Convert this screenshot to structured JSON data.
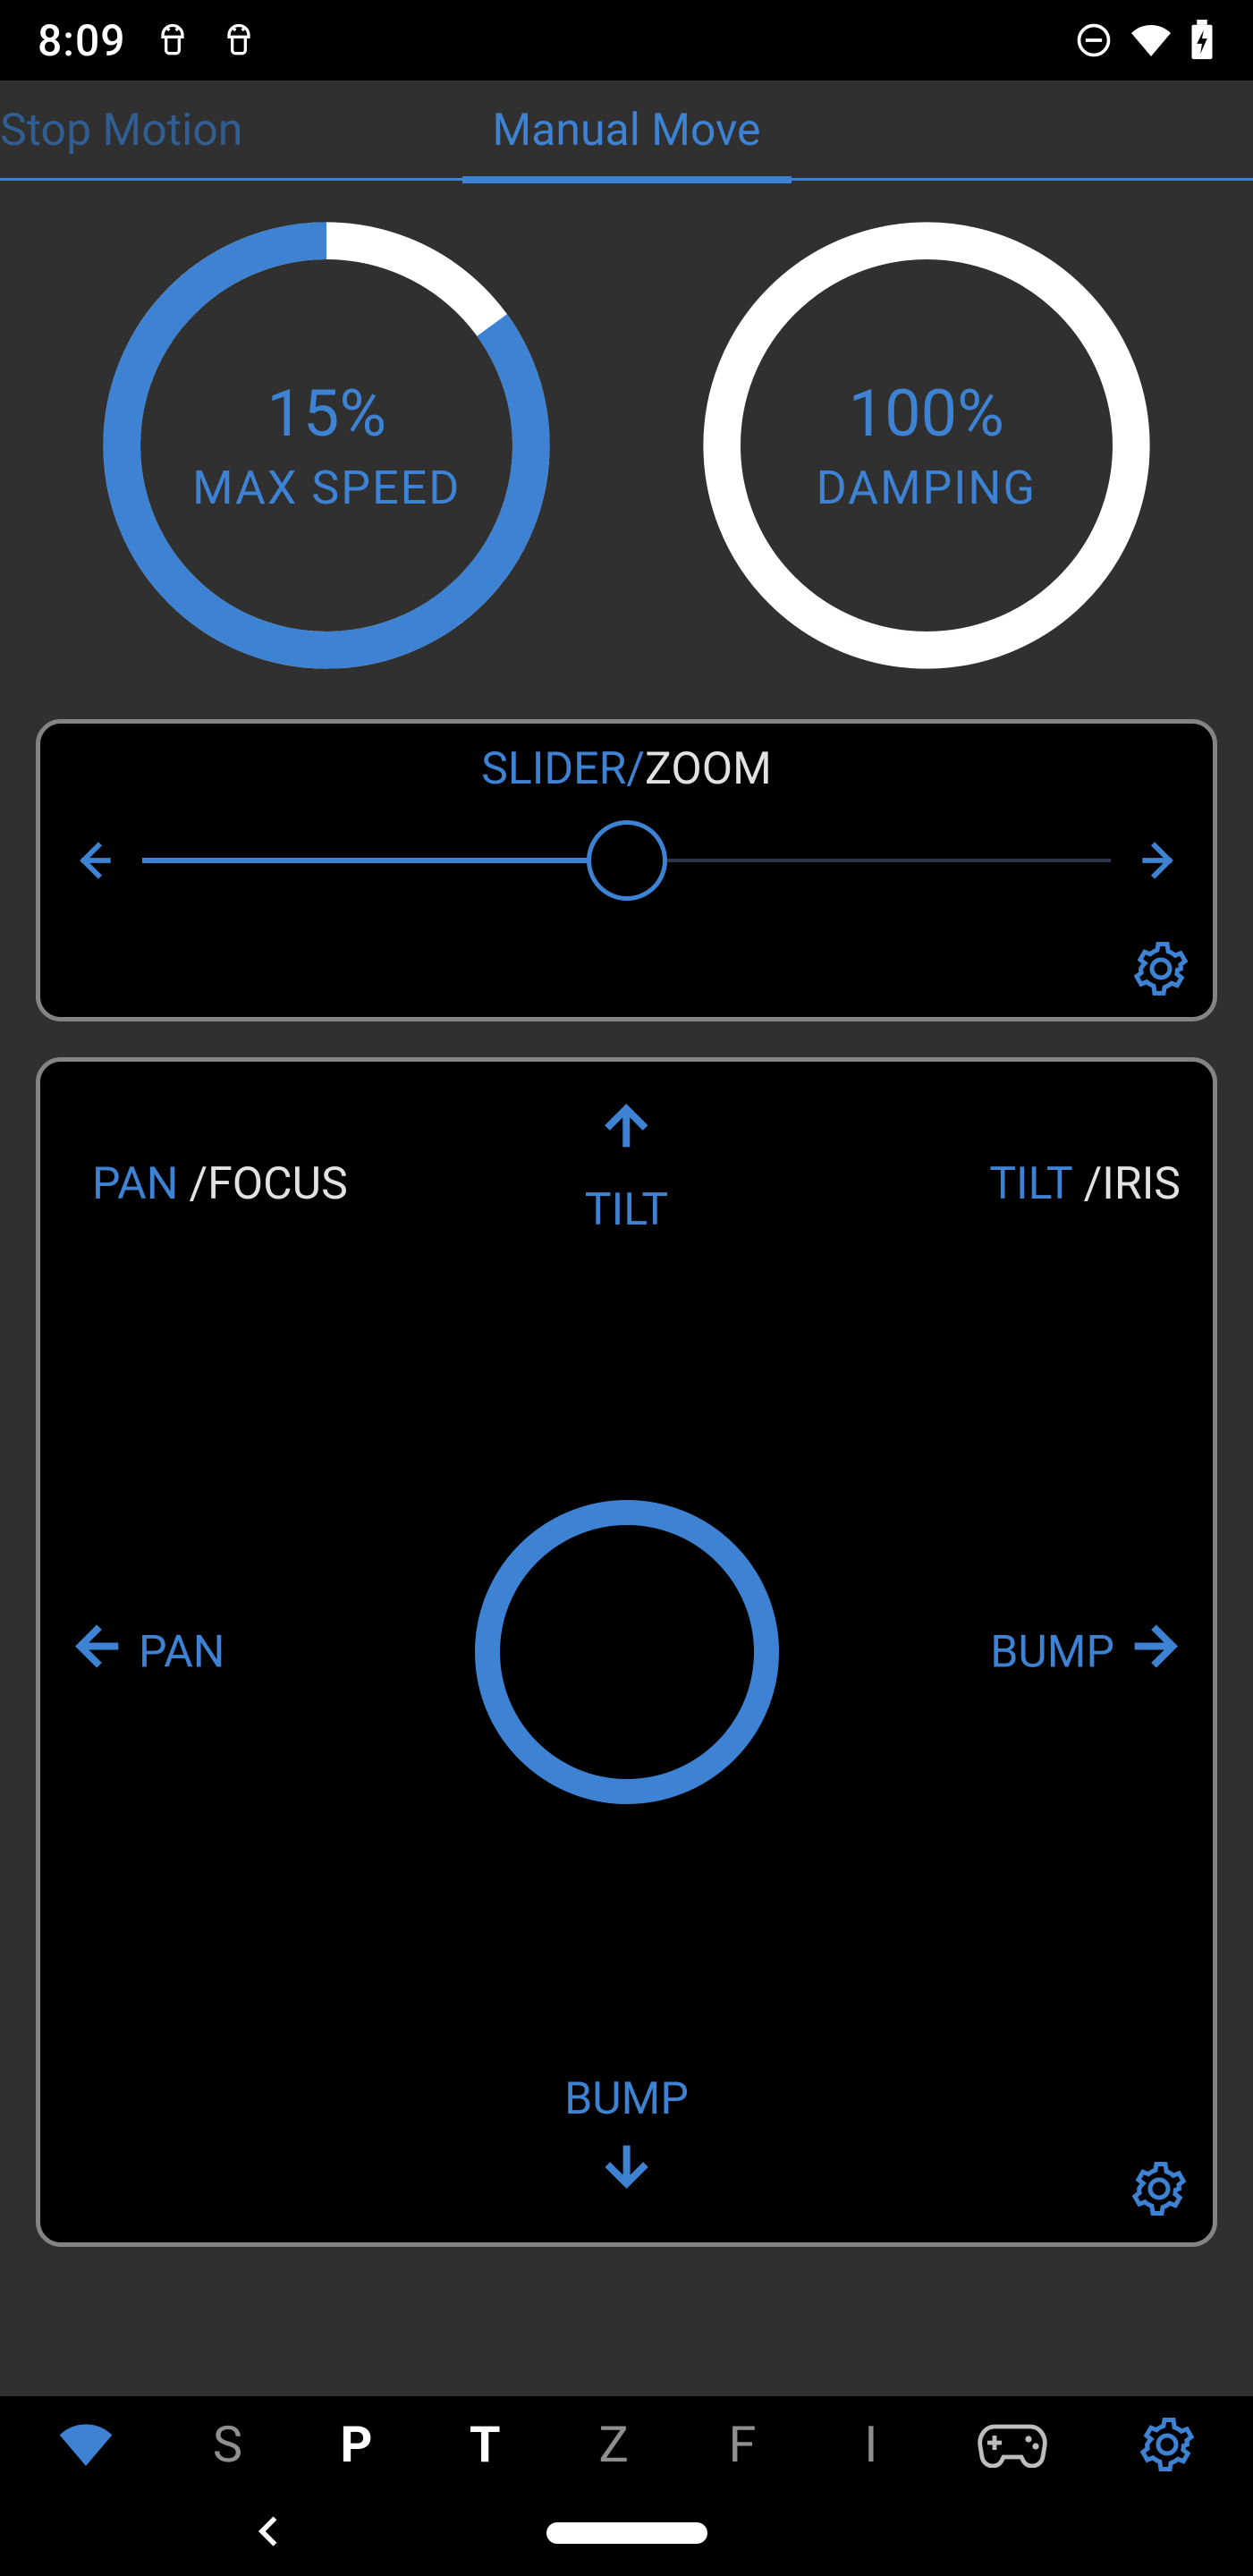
{
  "statusbar": {
    "time": "8:09"
  },
  "tabs": {
    "stop_motion": "Stop Motion",
    "manual_move": "Manual Move"
  },
  "gauges": {
    "max_speed": {
      "value": "15%",
      "label": "MAX SPEED",
      "fraction": 0.15
    },
    "damping": {
      "value": "100%",
      "label": "DAMPING",
      "fraction": 1.0
    }
  },
  "slider_panel": {
    "title_blue": "SLIDER/",
    "title_white": "ZOOM"
  },
  "joystick": {
    "pan_focus_blue": "PAN",
    "pan_focus_white": "/FOCUS",
    "tilt_iris_blue": "TILT",
    "tilt_iris_white": "/IRIS",
    "tilt": "TILT",
    "pan": "PAN",
    "bump_right": "BUMP",
    "bump_bottom": "BUMP"
  },
  "bottom": {
    "items": [
      "S",
      "P",
      "T",
      "Z",
      "F",
      "I"
    ]
  }
}
